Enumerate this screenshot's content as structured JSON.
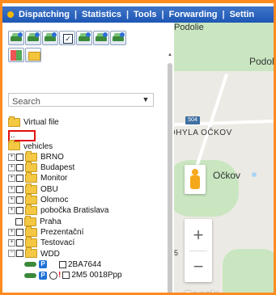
{
  "menu": {
    "items": [
      "Dispatching",
      "Statistics",
      "Tools",
      "Forwarding",
      "Settin"
    ]
  },
  "search": {
    "value": "Search"
  },
  "tree": {
    "virtual_file": "Virtual file",
    "parent": "..",
    "vehicles": "vehicles",
    "groups": [
      "BRNO",
      "Budapest",
      "Monitor",
      "OBU",
      "Olomoc",
      "pobočka Bratislava",
      "Praha",
      "Prezentační",
      "Testovací",
      "WDD"
    ],
    "vehicles_list": [
      {
        "plate": "2BA7644",
        "badge": "P"
      },
      {
        "plate": "2M5 0018Ppp",
        "badge": "P"
      }
    ]
  },
  "map": {
    "labels": {
      "podolie_top": "Podolie",
      "podoli_right": "Podoli",
      "ohyla": "OHYLA OČKOV",
      "ockov": "Očkov",
      "road": "504",
      "side": "5"
    },
    "zoom_in": "+",
    "zoom_out": "−",
    "brand": "Google"
  },
  "colors": {
    "accent": "#ff8a1e",
    "menubar": "#1d57b5",
    "folder": "#f4c842",
    "vehicle": "#3a8a3a"
  }
}
